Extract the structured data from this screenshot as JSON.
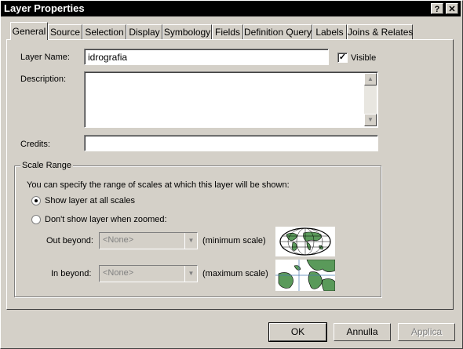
{
  "window": {
    "title": "Layer Properties",
    "help_label": "?",
    "close_label": "✕"
  },
  "tabs": [
    {
      "label": "General"
    },
    {
      "label": "Source"
    },
    {
      "label": "Selection"
    },
    {
      "label": "Display"
    },
    {
      "label": "Symbology"
    },
    {
      "label": "Fields"
    },
    {
      "label": "Definition Query"
    },
    {
      "label": "Labels"
    },
    {
      "label": "Joins & Relates"
    }
  ],
  "general": {
    "layer_name_label": "Layer Name:",
    "layer_name_value": "idrografia",
    "visible_label": "Visible",
    "visible_checked": true,
    "description_label": "Description:",
    "description_value": "",
    "credits_label": "Credits:",
    "credits_value": ""
  },
  "scale_range": {
    "group_label": "Scale Range",
    "intro": "You can specify the range of scales at which this layer will be shown:",
    "option_all": "Show layer at all scales",
    "option_zoomed": "Don't show layer when zoomed:",
    "selected_option": "all",
    "out_beyond_label": "Out beyond:",
    "out_beyond_value": "<None>",
    "out_beyond_hint": "(minimum scale)",
    "in_beyond_label": "In beyond:",
    "in_beyond_value": "<None>",
    "in_beyond_hint": "(maximum scale)"
  },
  "footer": {
    "ok_label": "OK",
    "cancel_label": "Annulla",
    "apply_label": "Applica"
  }
}
